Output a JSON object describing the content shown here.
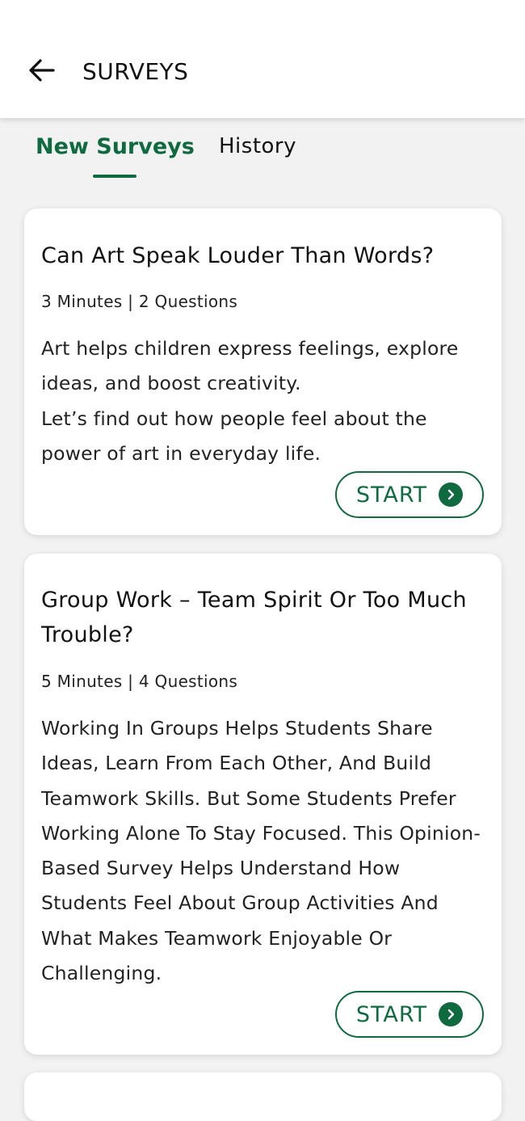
{
  "header": {
    "title": "SURVEYS",
    "back_icon": "arrow-left-icon"
  },
  "tabs": [
    {
      "label": "New Surveys",
      "active": true
    },
    {
      "label": "History",
      "active": false
    }
  ],
  "colors": {
    "accent": "#0f6b3f",
    "background": "#f2f2f2",
    "card": "#ffffff"
  },
  "surveys": [
    {
      "title": "Can Art Speak Louder Than Words?",
      "meta": "3 Minutes | 2 Questions",
      "description_lines": [
        "Art helps children express feelings, explore ideas, and boost creativity.",
        "Let’s find out how people feel about the power of art in everyday life."
      ],
      "button_label": "START",
      "button_icon": "chevron-right-circle-icon"
    },
    {
      "title": "Group Work – Team Spirit Or Too Much Trouble?",
      "meta": "5 Minutes | 4 Questions",
      "description_lines": [
        "Working In Groups Helps Students Share Ideas, Learn From Each Other, And Build Teamwork Skills. But Some Students Prefer Working Alone To Stay Focused. This Opinion-Based Survey Helps Understand How Students Feel About Group Activities And What Makes Teamwork Enjoyable Or Challenging."
      ],
      "button_label": "START",
      "button_icon": "chevron-right-circle-icon"
    }
  ]
}
